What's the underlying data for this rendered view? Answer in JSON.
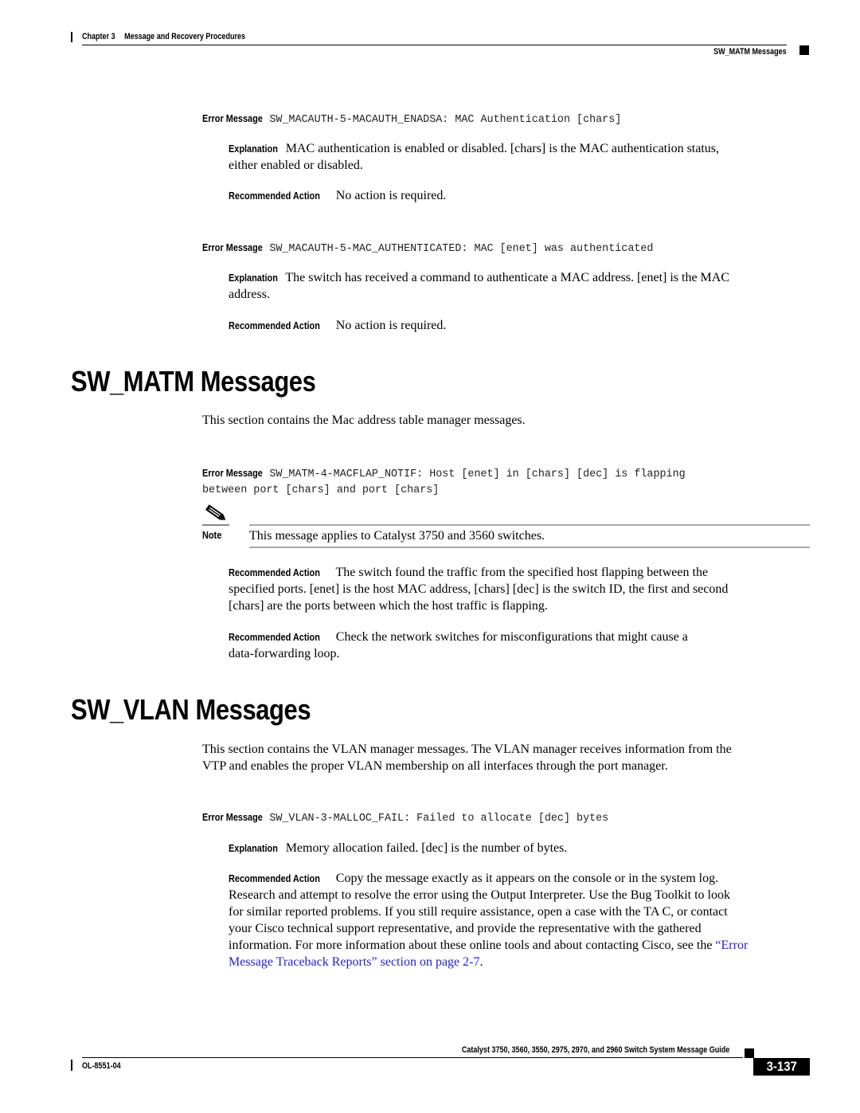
{
  "header": {
    "chapter_label": "Chapter 3",
    "chapter_title": "Message and Recovery Procedures",
    "section_title": "SW_MATM Messages"
  },
  "labels": {
    "error_message": "Error Message",
    "explanation": "Explanation",
    "recommended_action": "Recommended Action",
    "note": "Note"
  },
  "entries_top": [
    {
      "message": "SW_MACAUTH-5-MACAUTH_ENADSA: MAC Authentication [chars]",
      "explanation_lines": [
        "MAC authentication is enabled or disabled. [chars] is the MAC authentication status,",
        "either enabled or disabled."
      ],
      "action": "No action is required."
    },
    {
      "message": "SW_MACAUTH-5-MAC_AUTHENTICATED: MAC [enet] was authenticated",
      "explanation_lines": [
        "The switch has received a command to authenticate a MAC address. [enet] is the MAC",
        "address."
      ],
      "action": "No action is required."
    }
  ],
  "sw_matm": {
    "heading": "SW_MATM Messages",
    "intro": "This section contains the Mac address table manager messages.",
    "message_line1": "SW_MATM-4-MACFLAP_NOTIF: Host [enet] in [chars] [dec] is flapping",
    "message_line2": "between port [chars] and port [chars]",
    "note_text": "This message applies to Catalyst 3750 and 3560 switches.",
    "action1_lines": [
      "The switch found the traffic from the specified host flapping between the",
      "specified ports. [enet] is the host MAC address, [chars] [dec] is the switch ID, the first and second",
      "[chars] are the ports between which the host traffic is flapping."
    ],
    "action2_lines": [
      "Check the network switches for misconfigurations that might cause a",
      "data-forwarding loop."
    ]
  },
  "sw_vlan": {
    "heading": "SW_VLAN Messages",
    "intro_lines": [
      "This section contains the VLAN manager messages. The VLAN manager receives information from the",
      "VTP and enables the proper VLAN membership on all interfaces through the port manager."
    ],
    "message": "SW_VLAN-3-MALLOC_FAIL: Failed to allocate [dec] bytes",
    "explanation": "Memory allocation failed. [dec] is the number of bytes.",
    "action_lines": [
      "Copy the message exactly as it appears on the console or in the system log.",
      "Research and attempt to resolve the error using the Output Interpreter. Use the Bug Toolkit to look",
      "for similar reported problems. If you still require assistance, open a case with the TA C, or contact",
      "your Cisco technical support representative, and provide the representative with the gathered"
    ],
    "action_line5_text": "information. For more information about these online tools and about contacting Cisco, see the ",
    "action_link_part1": "“Error",
    "action_link_part2": "Message Traceback Reports” section on page 2-7",
    "action_end": "."
  },
  "footer": {
    "guide_title": "Catalyst 3750, 3560, 3550, 2975, 2970, and 2960 Switch System Message Guide",
    "doc_number": "OL-8551-04",
    "page_number": "3-137"
  },
  "colors": {
    "link": "#2222cc",
    "rule_gray": "#aaaaaa"
  }
}
